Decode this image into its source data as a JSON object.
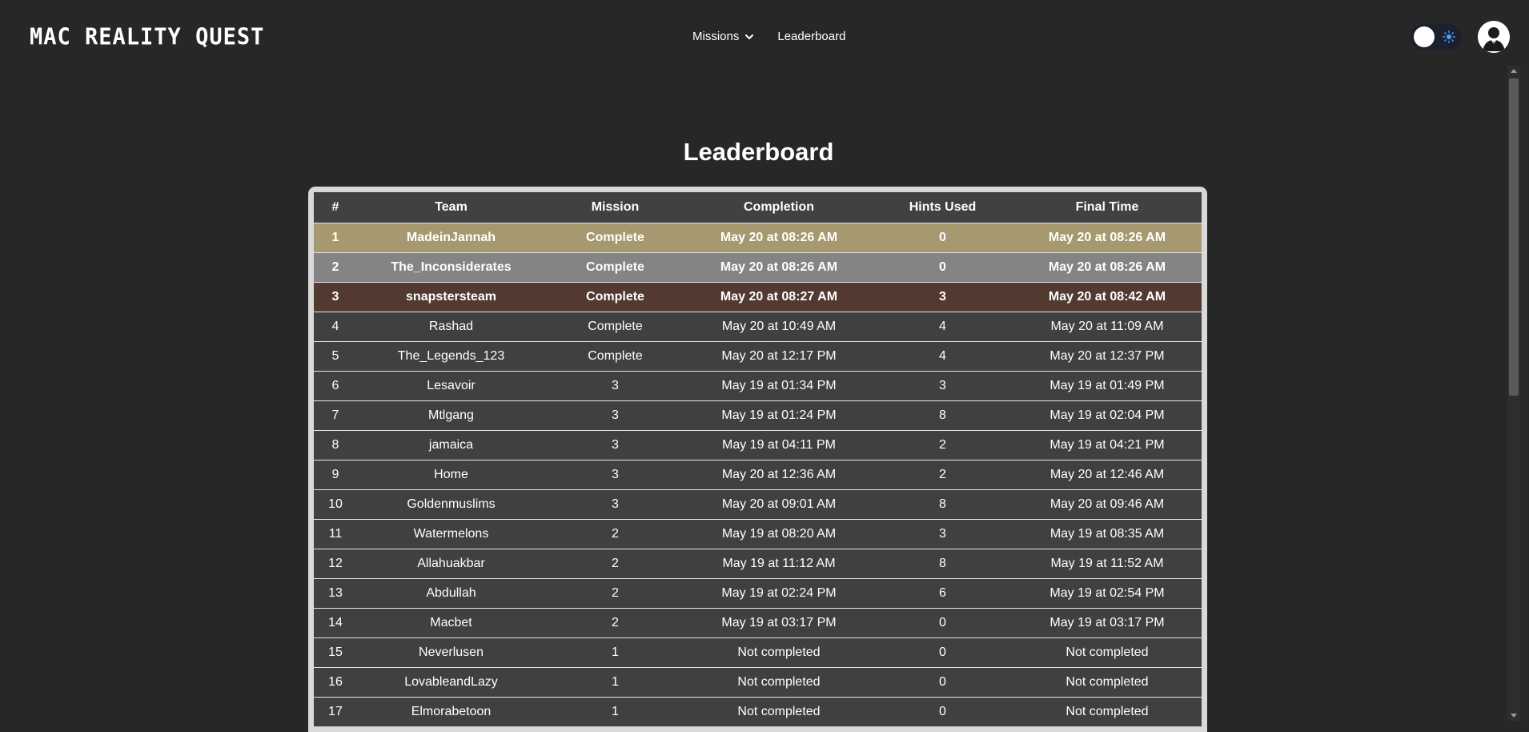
{
  "header": {
    "logo": "MAC REALITY QUEST",
    "nav": [
      {
        "label": "Missions",
        "has_dropdown": true
      },
      {
        "label": "Leaderboard",
        "has_dropdown": false
      }
    ],
    "theme_toggle": {
      "state": "light",
      "icon": "sun-icon"
    },
    "avatar_icon": "user-avatar-icon"
  },
  "colors": {
    "background": "#272727",
    "gold": "#a6996f",
    "silver": "#858383",
    "bronze": "#523a31",
    "row": "#404040"
  },
  "main": {
    "title": "Leaderboard",
    "columns": [
      "#",
      "Team",
      "Mission",
      "Completion",
      "Hints Used",
      "Final Time"
    ],
    "rows": [
      [
        "1",
        "MadeinJannah",
        "Complete",
        "May 20 at 08:26 AM",
        "0",
        "May 20 at 08:26 AM"
      ],
      [
        "2",
        "The_Inconsiderates",
        "Complete",
        "May 20 at 08:26 AM",
        "0",
        "May 20 at 08:26 AM"
      ],
      [
        "3",
        "snapstersteam",
        "Complete",
        "May 20 at 08:27 AM",
        "3",
        "May 20 at 08:42 AM"
      ],
      [
        "4",
        "Rashad",
        "Complete",
        "May 20 at 10:49 AM",
        "4",
        "May 20 at 11:09 AM"
      ],
      [
        "5",
        "The_Legends_123",
        "Complete",
        "May 20 at 12:17 PM",
        "4",
        "May 20 at 12:37 PM"
      ],
      [
        "6",
        "Lesavoir",
        "3",
        "May 19 at 01:34 PM",
        "3",
        "May 19 at 01:49 PM"
      ],
      [
        "7",
        "Mtlgang",
        "3",
        "May 19 at 01:24 PM",
        "8",
        "May 19 at 02:04 PM"
      ],
      [
        "8",
        "jamaica",
        "3",
        "May 19 at 04:11 PM",
        "2",
        "May 19 at 04:21 PM"
      ],
      [
        "9",
        "Home",
        "3",
        "May 20 at 12:36 AM",
        "2",
        "May 20 at 12:46 AM"
      ],
      [
        "10",
        "Goldenmuslims",
        "3",
        "May 20 at 09:01 AM",
        "8",
        "May 20 at 09:46 AM"
      ],
      [
        "11",
        "Watermelons",
        "2",
        "May 19 at 08:20 AM",
        "3",
        "May 19 at 08:35 AM"
      ],
      [
        "12",
        "Allahuakbar",
        "2",
        "May 19 at 11:12 AM",
        "8",
        "May 19 at 11:52 AM"
      ],
      [
        "13",
        "Abdullah",
        "2",
        "May 19 at 02:24 PM",
        "6",
        "May 19 at 02:54 PM"
      ],
      [
        "14",
        "Macbet",
        "2",
        "May 19 at 03:17 PM",
        "0",
        "May 19 at 03:17 PM"
      ],
      [
        "15",
        "Neverlusen",
        "1",
        "Not completed",
        "0",
        "Not completed"
      ],
      [
        "16",
        "LovableandLazy",
        "1",
        "Not completed",
        "0",
        "Not completed"
      ],
      [
        "17",
        "Elmorabetoon",
        "1",
        "Not completed",
        "0",
        "Not completed"
      ]
    ]
  }
}
